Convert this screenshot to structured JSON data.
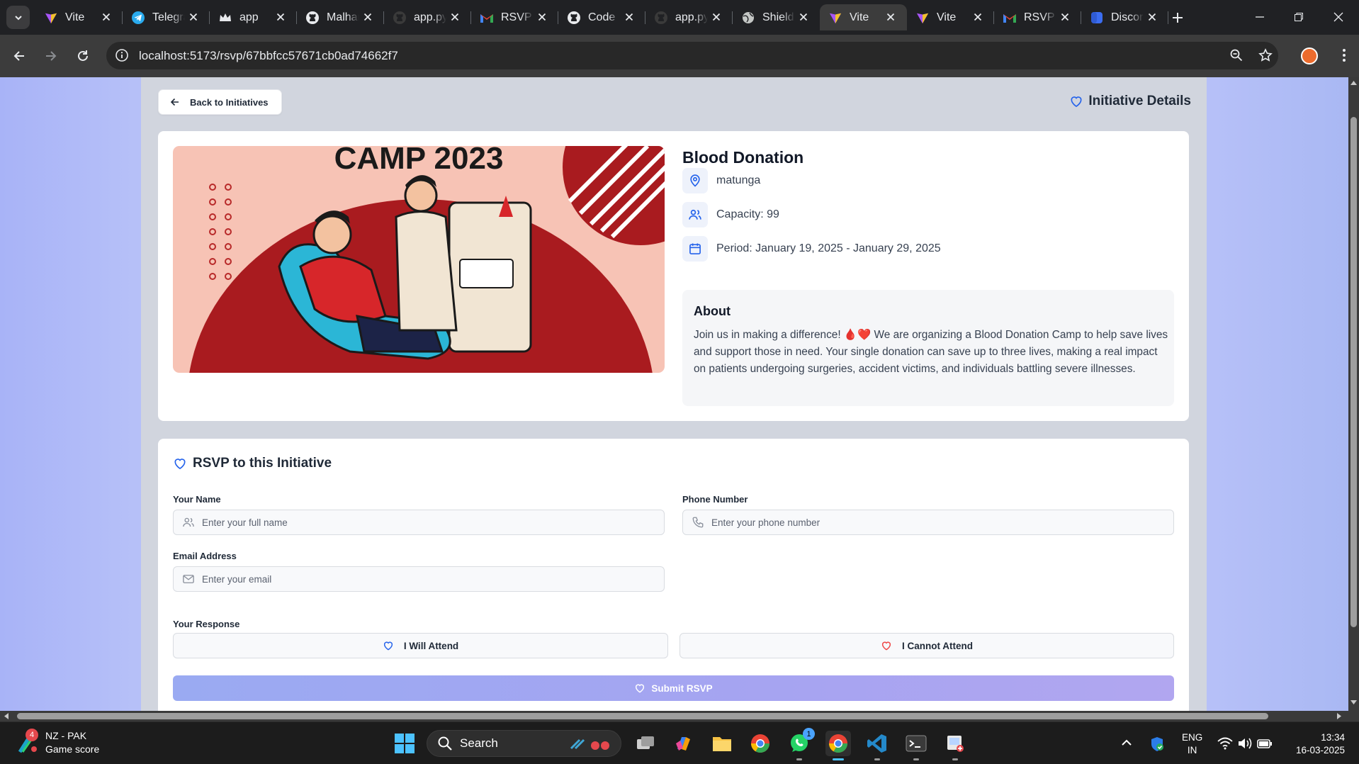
{
  "browser": {
    "tabs": [
      {
        "title": "Vite",
        "icon": "vite-icon",
        "active": false
      },
      {
        "title": "Telegram",
        "icon": "telegram-icon",
        "active": false
      },
      {
        "title": "app",
        "icon": "crown-icon",
        "active": false
      },
      {
        "title": "Malhar",
        "icon": "github-icon",
        "active": false
      },
      {
        "title": "app.py",
        "icon": "github-dark-icon",
        "active": false
      },
      {
        "title": "RSVP",
        "icon": "gmail-icon",
        "active": false
      },
      {
        "title": "Code",
        "icon": "github-icon",
        "active": false
      },
      {
        "title": "app.py",
        "icon": "github-dark-icon",
        "active": false
      },
      {
        "title": "Shield",
        "icon": "globe-icon",
        "active": false
      },
      {
        "title": "Vite",
        "icon": "vite-icon",
        "active": true
      },
      {
        "title": "Vite",
        "icon": "vite-icon",
        "active": false
      },
      {
        "title": "RSVP",
        "icon": "gmail-icon",
        "active": false
      },
      {
        "title": "Discord",
        "icon": "docs-icon",
        "active": false
      }
    ],
    "url": "localhost:5173/rsvp/67bbfcc57671cb0ad74662f7"
  },
  "page": {
    "back_label": "Back to Initiatives",
    "details_heading": "Initiative Details"
  },
  "event": {
    "banner_text": "CAMP 2023",
    "title": "Blood Donation",
    "location": "matunga",
    "capacity": "Capacity: 99",
    "period": "Period: January 19, 2025 - January 29, 2025",
    "about_title": "About",
    "about_text": "Join us in making a difference! 🩸❤️ We are organizing a Blood Donation Camp to help save lives and support those in need. Your single donation can save up to three lives, making a real impact on patients undergoing surgeries, accident victims, and individuals battling severe illnesses."
  },
  "rsvp": {
    "title": "RSVP to this Initiative",
    "name_label": "Your Name",
    "name_placeholder": "Enter your full name",
    "phone_label": "Phone Number",
    "phone_placeholder": "Enter your phone number",
    "email_label": "Email Address",
    "email_placeholder": "Enter your email",
    "response_label": "Your Response",
    "attend_label": "I Will Attend",
    "decline_label": "I Cannot Attend",
    "submit_label": "Submit RSVP"
  },
  "taskbar": {
    "weather_badge": "4",
    "weather_title": "NZ - PAK",
    "weather_subtitle": "Game score",
    "search_label": "Search",
    "whatsapp_badge": "1",
    "lang_line1": "ENG",
    "lang_line2": "IN",
    "time": "13:34",
    "date": "16-03-2025"
  },
  "colors": {
    "accent": "#2563eb",
    "decline_red": "#ef4444",
    "submit_gradient_start": "#9aaaf2",
    "submit_gradient_end": "#b1a6f0",
    "page_bg": "#d1d5de",
    "viewport_bg": "#b6c0f8"
  }
}
